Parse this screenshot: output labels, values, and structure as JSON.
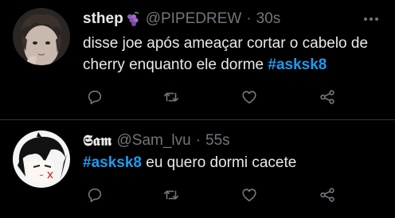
{
  "colors": {
    "background": "#000000",
    "text": "#e7e9ea",
    "muted": "#71767b",
    "hashtag": "#1d9bf0",
    "divider": "#2f3336"
  },
  "tweets": [
    {
      "display_name": "sthep",
      "name_emoji": "grapes-emoji",
      "handle": "@PIPEDREW",
      "separator": "·",
      "time": "30s",
      "text_before": "disse joe após ameaçar cortar o cabelo de cherry enquanto ele dorme ",
      "hashtag": "#asksk8",
      "text_after": "",
      "icons": [
        "reply-icon",
        "retweet-icon",
        "like-icon",
        "share-icon"
      ]
    },
    {
      "display_name": "𝕾𝖆𝖒",
      "handle": "@Sam_lvu",
      "separator": "·",
      "time": "55s",
      "text_before": "",
      "hashtag": "#asksk8",
      "text_after": " eu quero dormi cacete",
      "icons": [
        "reply-icon",
        "retweet-icon",
        "like-icon",
        "share-icon"
      ]
    }
  ]
}
